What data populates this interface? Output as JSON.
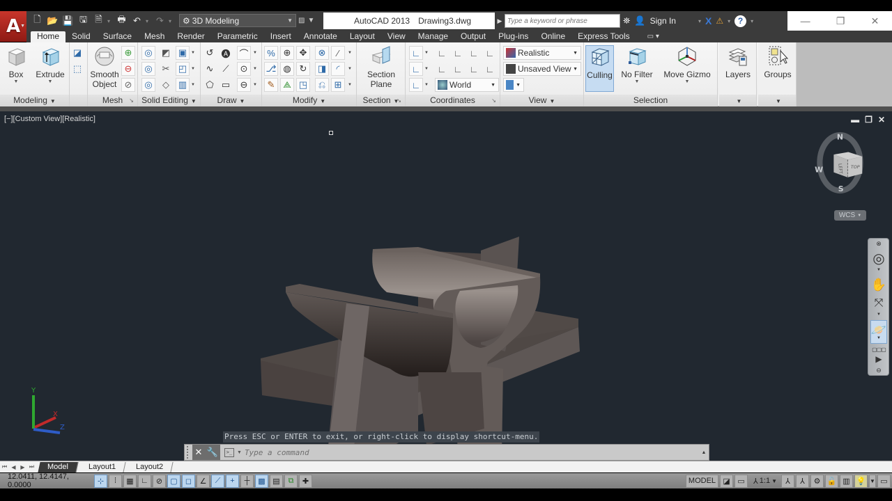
{
  "titlebar": {
    "app_menu_icon": "autocad-logo-icon",
    "quick_access": [
      "new-icon",
      "open-icon",
      "save-icon",
      "save-as-icon",
      "plot-preview-icon",
      "print-icon",
      "undo-icon",
      "redo-icon"
    ],
    "workspace": "3D Modeling",
    "app_name": "AutoCAD 2013",
    "file_name": "Drawing3.dwg",
    "search_placeholder": "Type a keyword or phrase",
    "sign_in": "Sign In",
    "window_controls": [
      "minimize",
      "restore",
      "close"
    ]
  },
  "tabs": [
    {
      "label": "Home",
      "active": true
    },
    {
      "label": "Solid"
    },
    {
      "label": "Surface"
    },
    {
      "label": "Mesh"
    },
    {
      "label": "Render"
    },
    {
      "label": "Parametric"
    },
    {
      "label": "Insert"
    },
    {
      "label": "Annotate"
    },
    {
      "label": "Layout"
    },
    {
      "label": "View"
    },
    {
      "label": "Manage"
    },
    {
      "label": "Output"
    },
    {
      "label": "Plug-ins"
    },
    {
      "label": "Online"
    },
    {
      "label": "Express Tools"
    }
  ],
  "ribbon": {
    "modeling": {
      "title": "Modeling",
      "box": "Box",
      "extrude": "Extrude"
    },
    "mesh": {
      "title": "Mesh",
      "smooth_object_1": "Smooth",
      "smooth_object_2": "Object"
    },
    "solid_editing": {
      "title": "Solid Editing"
    },
    "draw": {
      "title": "Draw"
    },
    "modify": {
      "title": "Modify"
    },
    "section": {
      "title": "Section",
      "section_plane_1": "Section",
      "section_plane_2": "Plane"
    },
    "coordinates": {
      "title": "Coordinates",
      "ucs_combo": "World"
    },
    "view": {
      "title": "View",
      "visual_style": "Realistic",
      "named_view": "Unsaved View"
    },
    "selection": {
      "title": "Selection",
      "culling": "Culling",
      "no_filter": "No Filter",
      "move_gizmo": "Move Gizmo"
    },
    "layers": {
      "label": "Layers"
    },
    "groups": {
      "label": "Groups"
    }
  },
  "viewport": {
    "label": "[−][Custom View][Realistic]",
    "viewcube": {
      "north": "N",
      "south": "S",
      "west": "W",
      "face_left": "LEFT",
      "face_top": "TOP"
    },
    "wcs": "WCS",
    "ucs_axes": {
      "x": "X",
      "y": "Y",
      "z": "Z"
    },
    "command_history": "Press ESC or ENTER to exit, or right-click to display shortcut-menu.",
    "command_placeholder": "Type a command"
  },
  "layout_tabs": [
    {
      "label": "Model",
      "active": true
    },
    {
      "label": "Layout1"
    },
    {
      "label": "Layout2"
    }
  ],
  "statusbar": {
    "coordinates": "12.0411, 12.4147, 0.0000",
    "space": "MODEL",
    "annotation_scale": "1:1"
  },
  "colors": {
    "viewport_bg": "#212830",
    "ribbon_bg": "#f3f3f3",
    "titlebar_bg": "#3b3b3b",
    "selected_blue": "#c6dcf2",
    "model_face": "#5e5755"
  }
}
